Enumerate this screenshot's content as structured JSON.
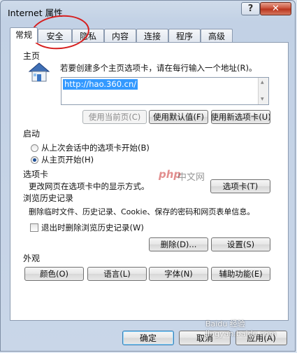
{
  "window": {
    "title": "Internet 属性",
    "help_label": "?",
    "close_label": "✕"
  },
  "tabs": [
    {
      "label": "常规",
      "active": true
    },
    {
      "label": "安全",
      "active": false
    },
    {
      "label": "隐私",
      "active": false
    },
    {
      "label": "内容",
      "active": false
    },
    {
      "label": "连接",
      "active": false
    },
    {
      "label": "程序",
      "active": false
    },
    {
      "label": "高级",
      "active": false
    }
  ],
  "homepage": {
    "section_label": "主页",
    "description": "若要创建多个主页选项卡，请在每行输入一个地址(R)。",
    "url": "http://hao.360.cn/",
    "buttons": {
      "use_current": "使用当前页(C)",
      "use_default": "使用默认值(F)",
      "use_new_tab": "使用新选项卡(U)"
    }
  },
  "startup": {
    "section_label": "启动",
    "option_last_session": "从上次会话中的选项卡开始(B)",
    "option_home": "从主页开始(H)",
    "selected": "home"
  },
  "tabs_section": {
    "section_label": "选项卡",
    "description": "更改网页在选项卡中的显示方式。",
    "button": "选项卡(T)"
  },
  "history": {
    "section_label": "浏览历史记录",
    "description": "删除临时文件、历史记录、Cookie、保存的密码和网页表单信息。",
    "checkbox_label": "退出时删除浏览历史记录(W)",
    "checked": false,
    "delete_button": "删除(D)...",
    "settings_button": "设置(S)"
  },
  "appearance": {
    "section_label": "外观",
    "buttons": [
      "颜色(O)",
      "语言(L)",
      "字体(N)",
      "辅助功能(E)"
    ]
  },
  "footer": {
    "ok": "确定",
    "cancel": "取消",
    "apply": "应用(A)"
  },
  "watermark": {
    "logo": "php",
    "text": "中文网",
    "bottom": "Baidu 经验 jingyan.baidu.com"
  },
  "colors": {
    "annotation_circle": "#d61e1e",
    "selection": "#3399ff",
    "close_button": "#c74a32"
  }
}
